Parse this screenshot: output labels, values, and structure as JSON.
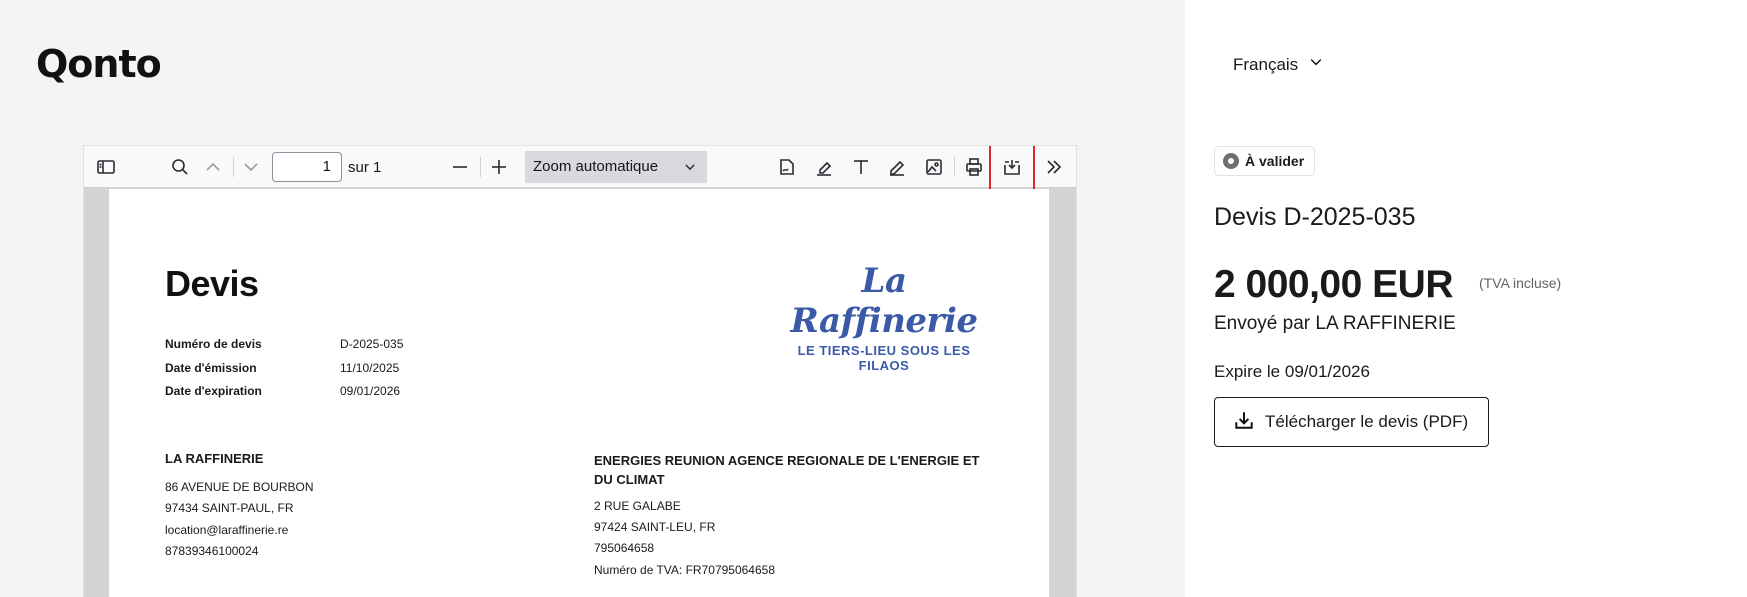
{
  "brand": {
    "logo": "Qonto"
  },
  "viewer": {
    "page_number": "1",
    "page_of": "sur 1",
    "zoom_label": "Zoom automatique",
    "highlight_color": "#e3262b"
  },
  "document": {
    "title": "Devis",
    "meta": [
      {
        "label": "Numéro de devis",
        "value": "D-2025-035"
      },
      {
        "label": "Date d'émission",
        "value": "11/10/2025"
      },
      {
        "label": "Date d'expiration",
        "value": "09/01/2026"
      }
    ],
    "logo_line1": "La Raffinerie",
    "logo_line2": "LE TIERS-LIEU SOUS LES FILAOS",
    "sender": {
      "name": "LA RAFFINERIE",
      "lines": [
        "86 AVENUE DE BOURBON",
        "97434 SAINT-PAUL, FR",
        "location@laraffinerie.re",
        "87839346100024"
      ]
    },
    "client": {
      "name": "ENERGIES REUNION AGENCE REGIONALE DE L'ENERGIE ET DU CLIMAT",
      "lines": [
        "2 RUE GALABE",
        "97424 SAINT-LEU, FR",
        "795064658",
        "Numéro de TVA: FR70795064658"
      ]
    }
  },
  "panel": {
    "language": "Français",
    "status": "À valider",
    "quote_id": "Devis D-2025-035",
    "amount": "2 000,00 EUR",
    "tva_note": "(TVA incluse)",
    "sent_by": "Envoyé par LA RAFFINERIE",
    "expires": "Expire le 09/01/2026",
    "download_label": "Télécharger le devis (PDF)"
  }
}
